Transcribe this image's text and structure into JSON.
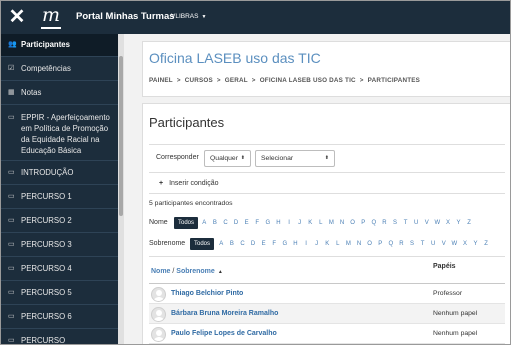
{
  "navbar": {
    "close_icon": "close-icon",
    "logo_letter": "m",
    "title": "Portal Minhas Turmas",
    "language": "VLIBRAS"
  },
  "sidebar": {
    "items": [
      {
        "icon": "users-icon",
        "glyph": "👥",
        "label": "Participantes",
        "active": true
      },
      {
        "icon": "badge-check-icon",
        "glyph": "☑",
        "label": "Competências"
      },
      {
        "icon": "grades-icon",
        "glyph": "▦",
        "label": "Notas"
      },
      {
        "icon": "folder-icon",
        "glyph": "▭",
        "label": "EPPIR - Aperfeiçoamento em Política de Promoção da Equidade Racial na Educação Básica"
      },
      {
        "icon": "folder-icon",
        "glyph": "▭",
        "label": "INTRODUÇÃO"
      },
      {
        "icon": "folder-icon",
        "glyph": "▭",
        "label": "PERCURSO 1"
      },
      {
        "icon": "folder-icon",
        "glyph": "▭",
        "label": "PERCURSO 2"
      },
      {
        "icon": "folder-icon",
        "glyph": "▭",
        "label": "PERCURSO 3"
      },
      {
        "icon": "folder-icon",
        "glyph": "▭",
        "label": "PERCURSO 4"
      },
      {
        "icon": "folder-icon",
        "glyph": "▭",
        "label": "PERCURSO 5"
      },
      {
        "icon": "folder-icon",
        "glyph": "▭",
        "label": "PERCURSO 6"
      },
      {
        "icon": "folder-icon",
        "glyph": "▭",
        "label": "PERCURSO"
      }
    ]
  },
  "header": {
    "course_title": "Oficina LASEB uso das TIC",
    "breadcrumb": [
      "PAINEL",
      "CURSOS",
      "GERAL",
      "OFICINA LASEB USO DAS TIC",
      "PARTICIPANTES"
    ]
  },
  "main": {
    "heading": "Participantes",
    "filter": {
      "label": "Corresponder",
      "match_value": "Qualquer",
      "select_value": "Selecionar",
      "add_condition": "Inserir condição"
    },
    "count_text": "5 participantes encontrados",
    "initials": {
      "first_label": "Nome",
      "last_label": "Sobrenome",
      "all_label": "Todos",
      "letters": [
        "A",
        "B",
        "C",
        "D",
        "E",
        "F",
        "G",
        "H",
        "I",
        "J",
        "K",
        "L",
        "M",
        "N",
        "O",
        "P",
        "Q",
        "R",
        "S",
        "T",
        "U",
        "V",
        "W",
        "X",
        "Y",
        "Z"
      ]
    },
    "table": {
      "col_name_first": "Nome",
      "col_name_sep": " / ",
      "col_name_last": "Sobrenome",
      "col_roles": "Papéis",
      "rows": [
        {
          "name": "Thiago Belchior Pinto",
          "role": "Professor"
        },
        {
          "name": "Bárbara Bruna Moreira Ramalho",
          "role": "Nenhum papel"
        },
        {
          "name": "Paulo Felipe Lopes de Carvalho",
          "role": "Nenhum papel"
        }
      ]
    }
  },
  "colors": {
    "navbar_bg": "#1c2d3c",
    "link": "#2f6aa3",
    "title_blue": "#5b8fbf"
  }
}
